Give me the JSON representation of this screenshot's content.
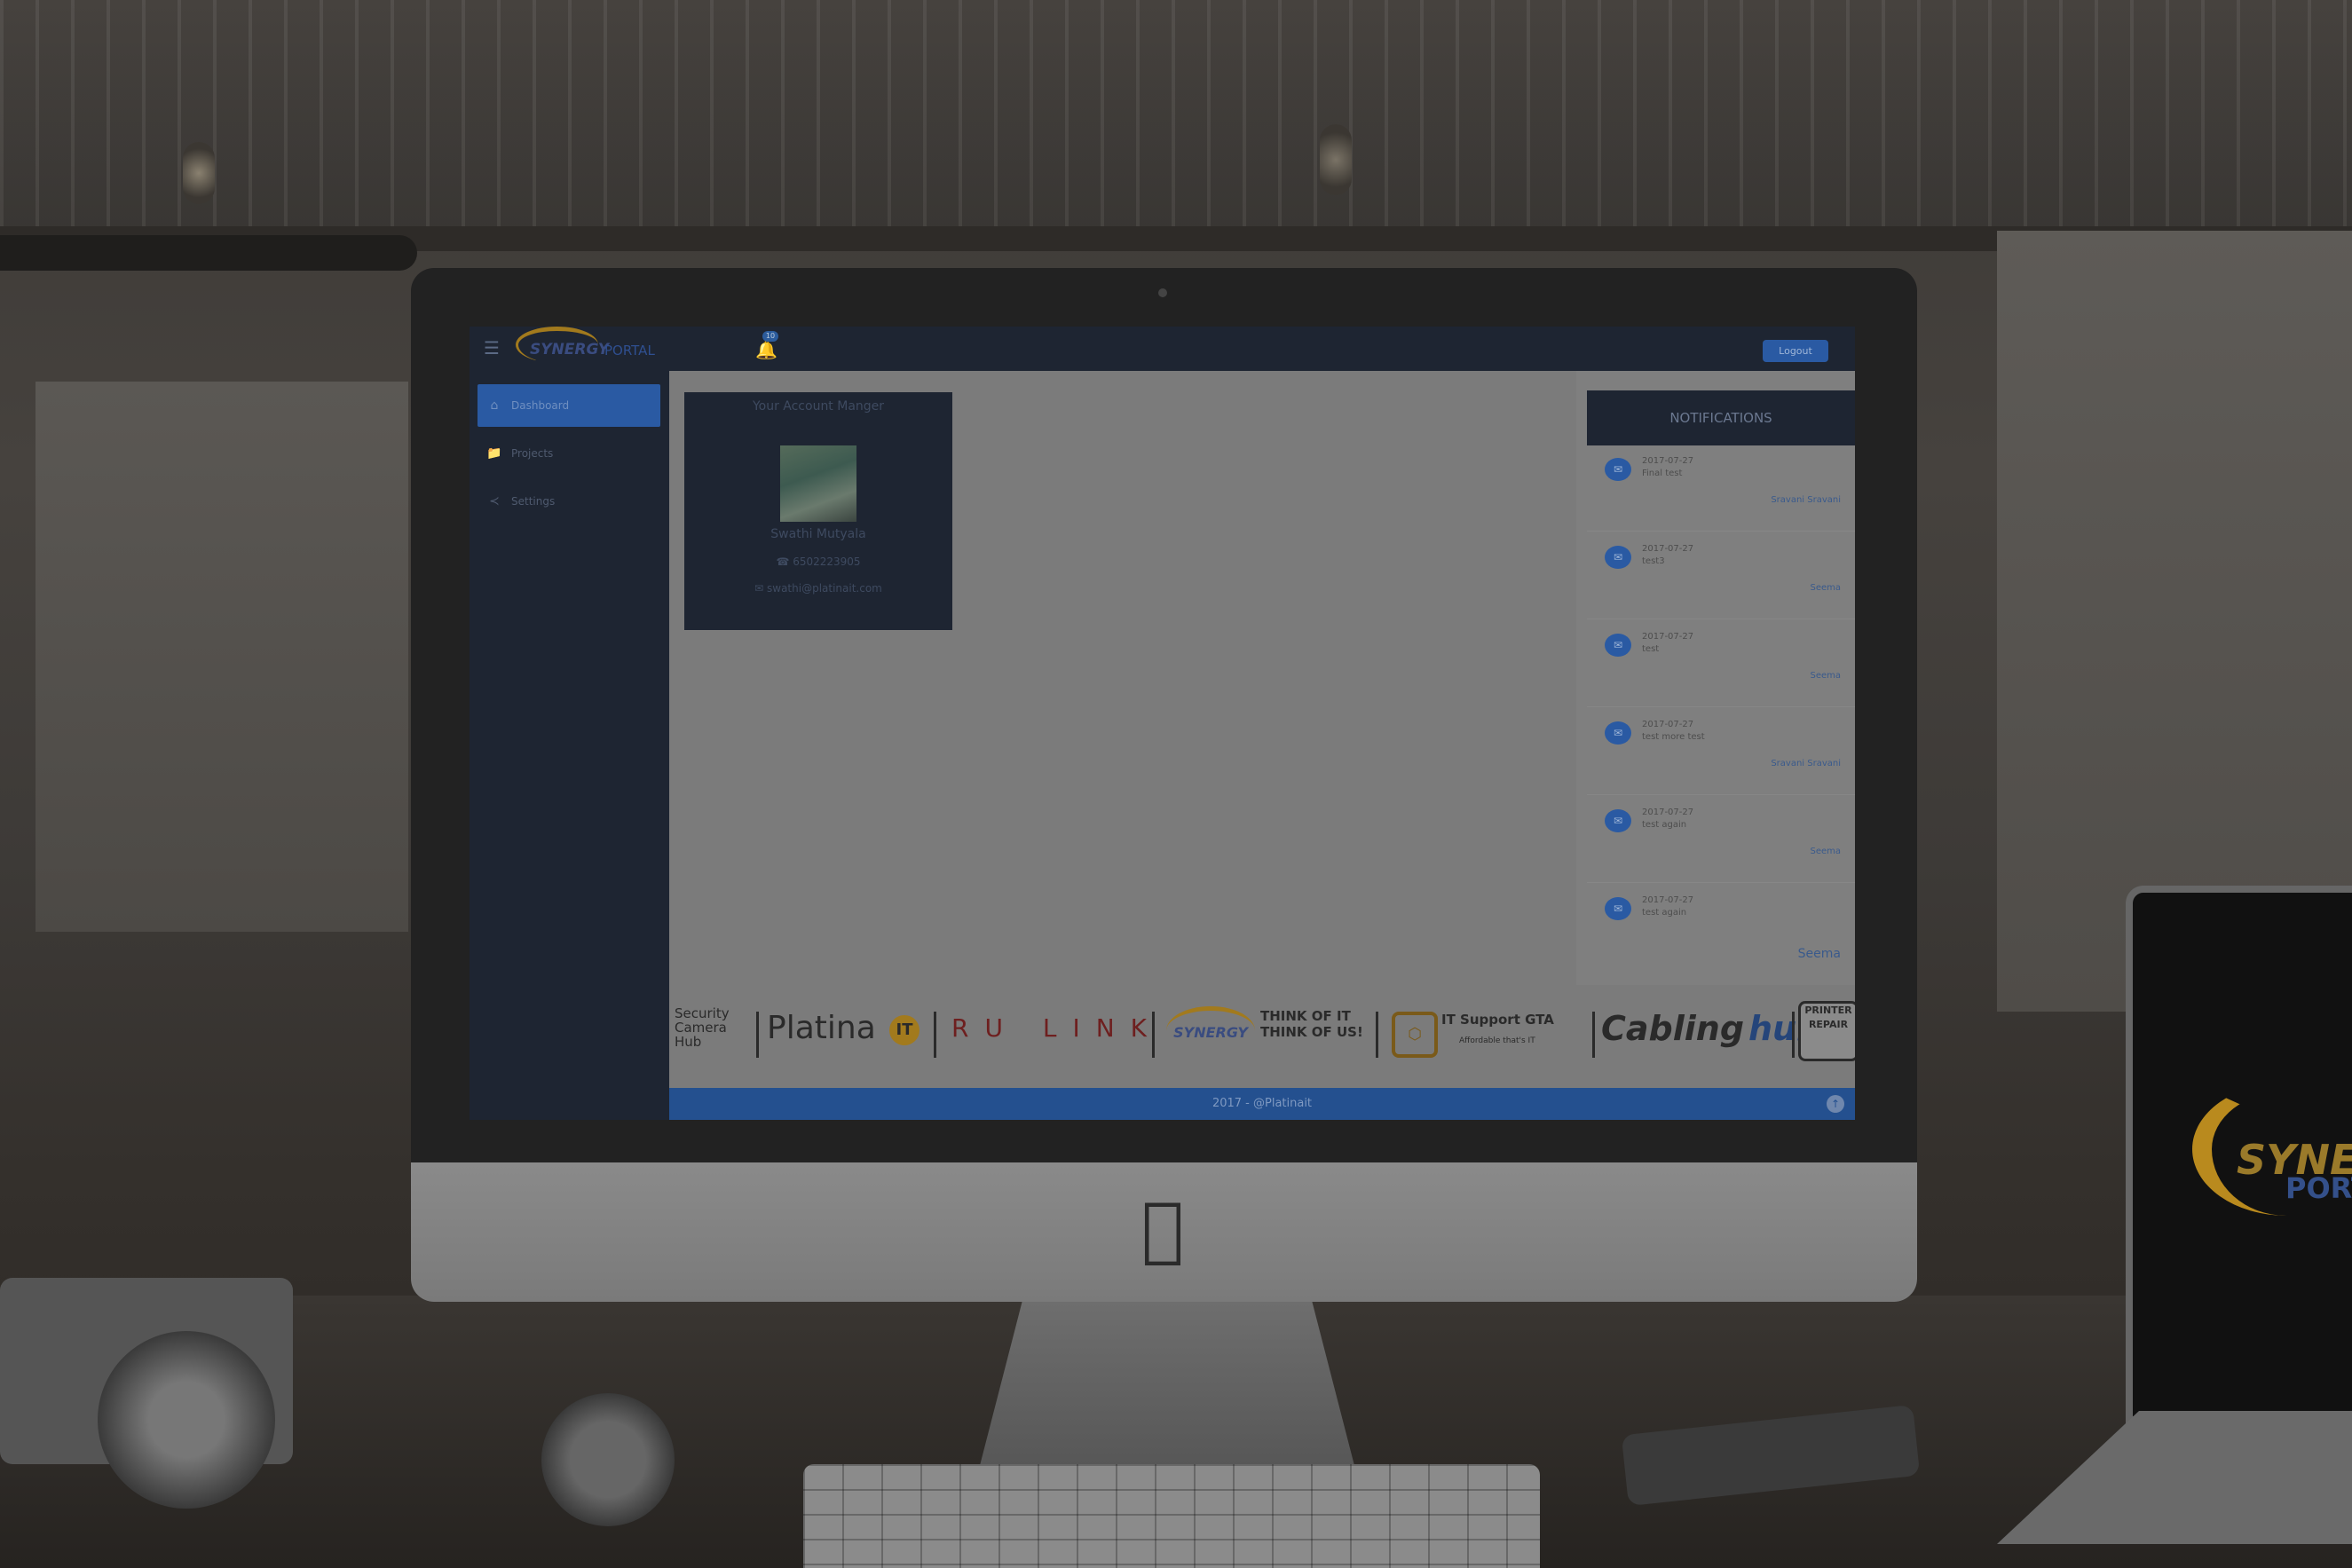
{
  "app": {
    "logo_text": "SYNERGY",
    "logo_sub": "PORTAL",
    "notification_badge": "10",
    "logout_label": "Logout"
  },
  "sidebar": {
    "items": [
      {
        "label": "Dashboard",
        "icon": "home-icon"
      },
      {
        "label": "Projects",
        "icon": "folder-icon"
      },
      {
        "label": "Settings",
        "icon": "share-icon"
      }
    ]
  },
  "account_manager": {
    "title": "Your Account Manger",
    "name": "Swathi Mutyala",
    "phone": "☎ 6502223905",
    "email": "✉ swathi@platinait.com"
  },
  "notifications": {
    "heading": "NOTIFICATIONS",
    "items": [
      {
        "date": "2017-07-27",
        "text": "Final test",
        "author": "Sravani Sravani"
      },
      {
        "date": "2017-07-27",
        "text": "test3",
        "author": "Seema"
      },
      {
        "date": "2017-07-27",
        "text": "test",
        "author": "Seema"
      },
      {
        "date": "2017-07-27",
        "text": "test more test",
        "author": "Sravani Sravani"
      },
      {
        "date": "2017-07-27",
        "text": "test again",
        "author": "Seema"
      },
      {
        "date": "2017-07-27",
        "text": "test again",
        "author": "Seema"
      }
    ]
  },
  "brands": {
    "security": "Security Camera Hub",
    "platina": "Platina",
    "platina_badge": "IT",
    "rulink": "RU LINK",
    "synergy": "SYNERGY",
    "think": "THINK OF IT THINK OF US!",
    "itsupport": "IT Support GTA",
    "itsupport_sub": "Affordable that's IT",
    "cabling": "Cabling",
    "cabling_hub": "hub",
    "printer": "PRINTER REPAIR"
  },
  "footer": {
    "text": "2017 - @Platinait",
    "scroll_up": "↑"
  },
  "laptop": {
    "logo_text": "SYNE",
    "logo_sub": "PORT"
  },
  "colors": {
    "nav_bg": "#1e2532",
    "accent": "#2a5aa3",
    "logo_gold": "#a27a1d"
  }
}
